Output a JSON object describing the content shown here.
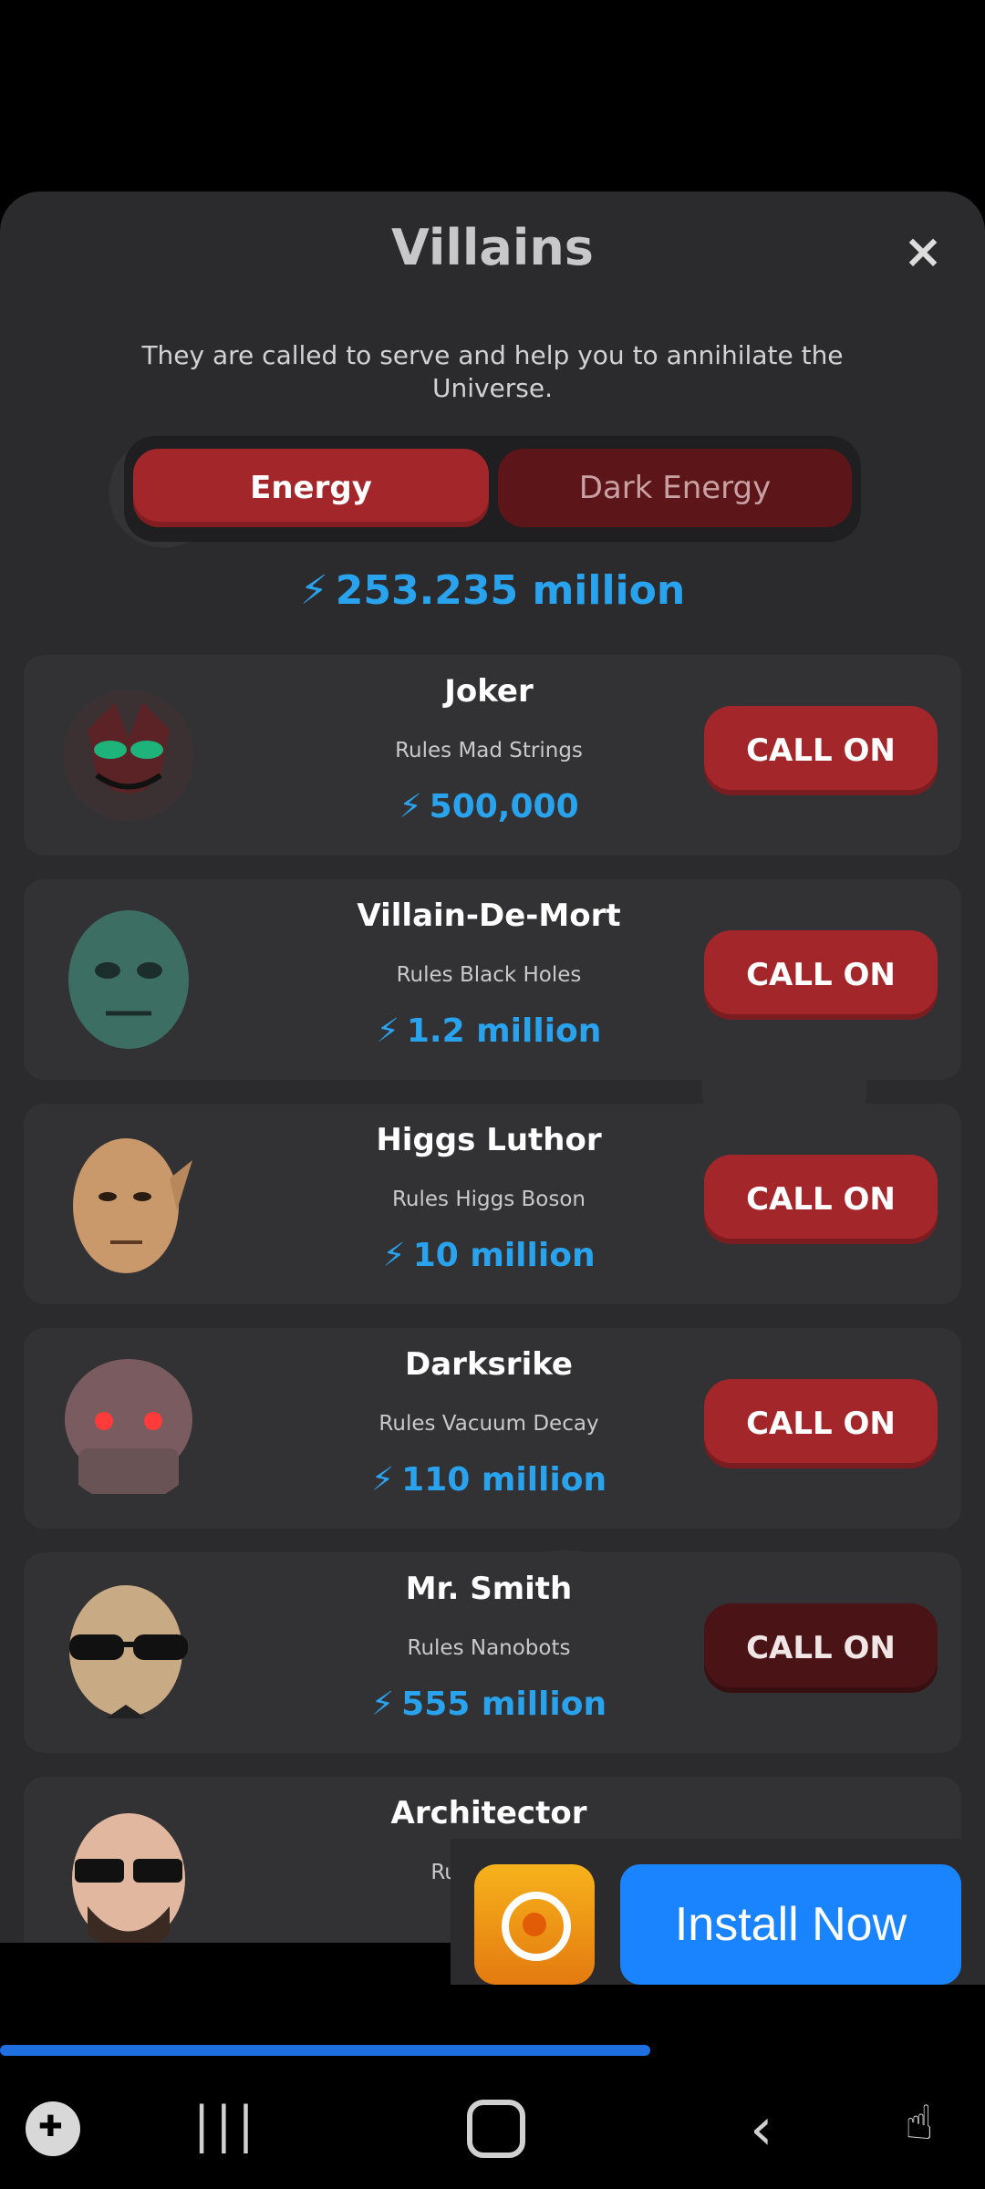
{
  "title": "Villains",
  "close_label": "×",
  "subtitle": "They are called to serve and help you to annihilate the Universe.",
  "tabs": {
    "energy": "Energy",
    "dark_energy": "Dark Energy"
  },
  "balance": "253.235 million",
  "bolt_icon": "⚡",
  "villains": [
    {
      "name": "Joker",
      "desc": "Rules Mad Strings",
      "cost": "500,000",
      "button": "CALL ON"
    },
    {
      "name": "Villain-De-Mort",
      "desc": "Rules Black Holes",
      "cost": "1.2 million",
      "button": "CALL ON"
    },
    {
      "name": "Higgs Luthor",
      "desc": "Rules Higgs Boson",
      "cost": "10 million",
      "button": "CALL ON"
    },
    {
      "name": "Darksrike",
      "desc": "Rules Vacuum Decay",
      "cost": "110 million",
      "button": "CALL ON"
    },
    {
      "name": "Mr. Smith",
      "desc": "Rules Nanobots",
      "cost": "555 million",
      "button": "CALL ON"
    },
    {
      "name": "Architector",
      "desc": "Rules Simu",
      "cost": "",
      "button": ""
    }
  ],
  "ad": {
    "install_label": "Install Now"
  },
  "video_progress": 0.66,
  "nav": {
    "recent": "|||",
    "back": "‹"
  },
  "colors": {
    "accent_red": "#a3262b",
    "energy_blue": "#2aa3ef",
    "install_blue": "#1a84ff"
  }
}
